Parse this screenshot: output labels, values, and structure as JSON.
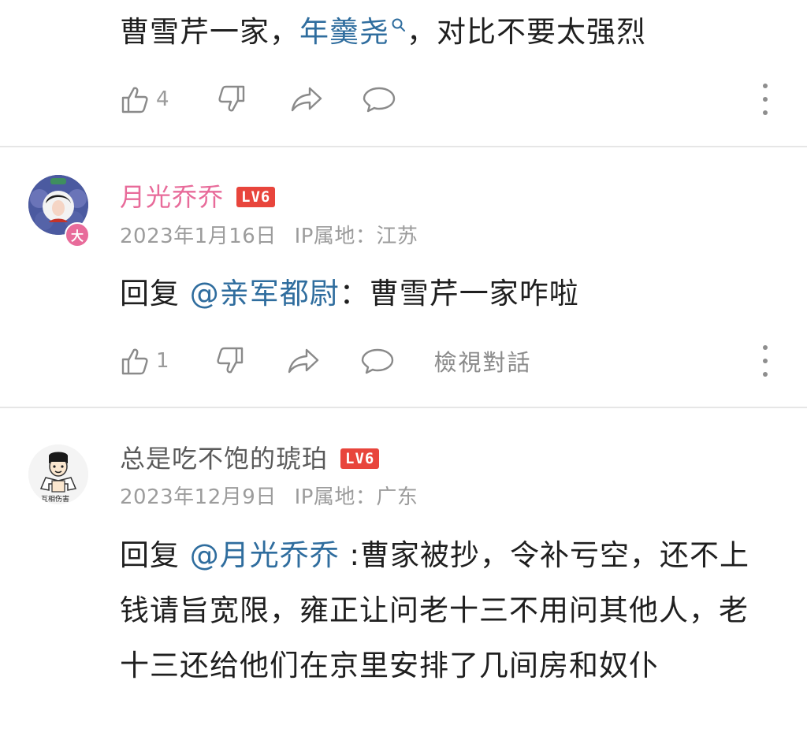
{
  "colors": {
    "link": "#2f6d9e",
    "username_pink": "#e86b9a",
    "username_gray": "#5a5a5a",
    "level_badge": "#e8453c",
    "meta_gray": "#9c9c9c"
  },
  "top_comment": {
    "text_prefix": "曹雪芹一家，",
    "link_text": "年羹尧",
    "text_suffix": "，对比不要太强烈",
    "like_count": "4"
  },
  "comments": [
    {
      "username": "月光乔乔",
      "level": "LV6",
      "date": "2023年1月16日",
      "ip_location": "IP属地：江苏",
      "avatar_badge": "大",
      "reply_prefix": "回复 ",
      "mention": "@亲军都尉",
      "body": "：曹雪芹一家咋啦",
      "like_count": "1",
      "view_conversation": "檢視對話"
    },
    {
      "username": "总是吃不饱的琥珀",
      "level": "LV6",
      "date": "2023年12月9日",
      "ip_location": "IP属地：广东",
      "avatar_caption": "互相伤害",
      "reply_prefix": "回复 ",
      "mention": "@月光乔乔",
      "body": " :曹家被抄，令补亏空，还不上钱请旨宽限，雍正让问老十三不用问其他人，老十三还给他们在京里安排了几间房和奴仆"
    }
  ],
  "icons": {
    "like": "thumbs-up-icon",
    "dislike": "thumbs-down-icon",
    "share": "share-arrow-icon",
    "comment": "comment-bubble-icon",
    "more": "more-vertical-icon",
    "search": "search-icon"
  }
}
